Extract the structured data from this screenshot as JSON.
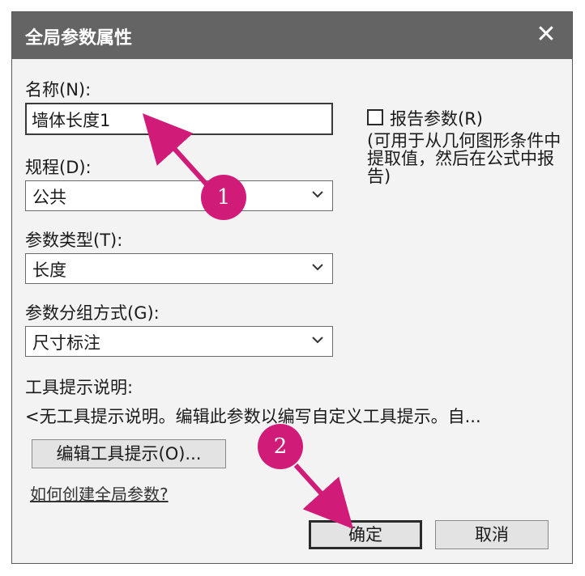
{
  "window": {
    "title": "全局参数属性",
    "close_glyph": "✕"
  },
  "form": {
    "name_label": "名称(N):",
    "name_value": "墙体长度1",
    "discipline_label": "规程(D):",
    "discipline_value": "公共",
    "param_type_label": "参数类型(T):",
    "param_type_value": "长度",
    "group_label": "参数分组方式(G):",
    "group_value": "尺寸标注",
    "report_checkbox_label": "报告参数(R)",
    "report_checked": false,
    "report_note": "(可用于从几何图形条件中提取值，然后在公式中报告)"
  },
  "tooltip": {
    "label": "工具提示说明:",
    "text": "<无工具提示说明。编辑此参数以编写自定义工具提示。自...",
    "edit_button": "编辑工具提示(O)..."
  },
  "help_link": "如何创建全局参数?",
  "buttons": {
    "ok": "确定",
    "cancel": "取消"
  },
  "annotations": {
    "marker1": "1",
    "marker2": "2",
    "color": "#d11b78"
  },
  "icons": {
    "close": "close-icon",
    "dropdown": "chevron-down-icon"
  }
}
